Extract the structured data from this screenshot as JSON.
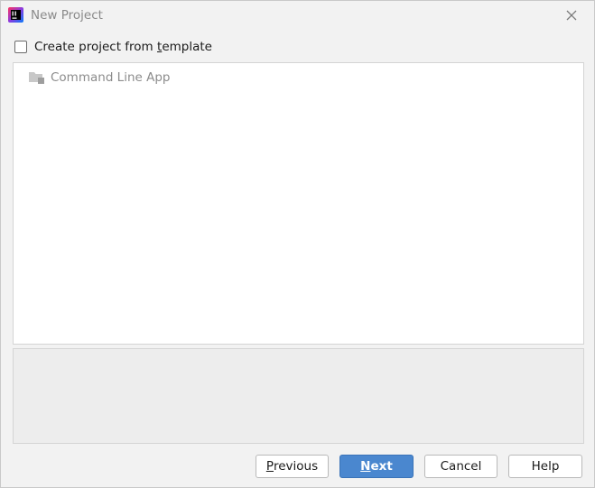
{
  "window": {
    "title": "New Project"
  },
  "template_option": {
    "label_before": "Create project from ",
    "label_mnemonic": "t",
    "label_after": "emplate",
    "checked": false
  },
  "templates": {
    "items": [
      {
        "label": "Command Line App",
        "icon": "folder-icon"
      }
    ]
  },
  "buttons": {
    "previous": {
      "mnemonic": "P",
      "rest": "revious"
    },
    "next": {
      "mnemonic": "N",
      "rest": "ext"
    },
    "cancel": {
      "label": "Cancel"
    },
    "help": {
      "label": "Help"
    }
  },
  "colors": {
    "accent": "#4a87cf",
    "background": "#f2f2f2",
    "panel": "#ffffff"
  }
}
